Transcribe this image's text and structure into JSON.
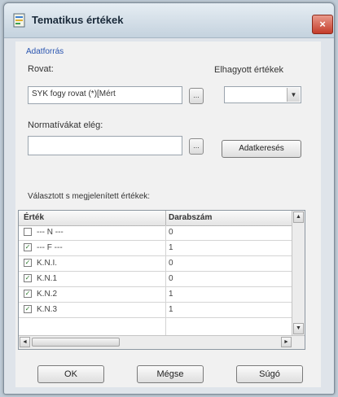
{
  "window": {
    "title": "Tematikus értékek",
    "close": "×"
  },
  "group": {
    "legend": "Adatforrás"
  },
  "fields": {
    "field_label": "Rovat:",
    "field_value": "SYK fogy rovat (*)[Mért",
    "separator_label": "Elhagyott értékek",
    "database_label": "Normatívákat elég:",
    "database_value": "",
    "browse": "..."
  },
  "buttons": {
    "apply": "Adatkeresés",
    "ok": "OK",
    "cancel": "Mégse",
    "help": "Súgó"
  },
  "table": {
    "label": "Választott s megjelenített értékek:",
    "columns": [
      "Érték",
      "Darabszám"
    ],
    "rows": [
      {
        "value": "--- N ---",
        "count": "0",
        "checked": false
      },
      {
        "value": "--- F ---",
        "count": "1",
        "checked": true
      },
      {
        "value": "K.N.I.",
        "count": "0",
        "checked": true
      },
      {
        "value": "K.N.1",
        "count": "0",
        "checked": true
      },
      {
        "value": "K.N.2",
        "count": "1",
        "checked": true
      },
      {
        "value": "K.N.3",
        "count": "1",
        "checked": true
      }
    ]
  },
  "scroll": {
    "up": "▲",
    "down": "▼",
    "left": "◄",
    "right": "►"
  },
  "icons": {
    "app": "app-document-icon",
    "dropdown": "chevron-down-icon"
  }
}
